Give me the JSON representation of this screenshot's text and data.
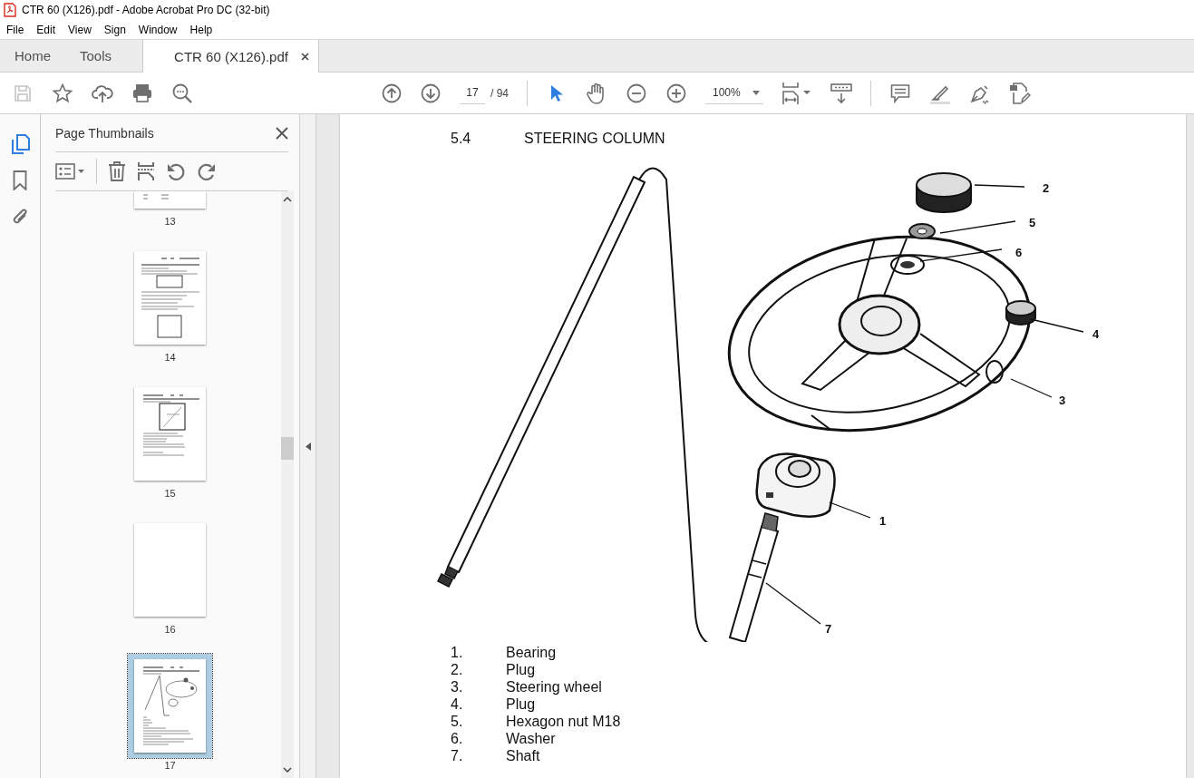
{
  "window": {
    "title": "CTR 60 (X126).pdf - Adobe Acrobat Pro DC (32-bit)"
  },
  "menu": [
    "File",
    "Edit",
    "View",
    "Sign",
    "Window",
    "Help"
  ],
  "tabs": [
    {
      "label": "Home",
      "selected": false,
      "closable": false
    },
    {
      "label": "Tools",
      "selected": false,
      "closable": false
    },
    {
      "label": "CTR 60 (X126).pdf",
      "selected": true,
      "closable": true
    }
  ],
  "toolbar": {
    "page": "17",
    "page_count": "/ 94",
    "zoom": "100%",
    "save_disabled": true
  },
  "sidebar": {
    "title": "Page Thumbnails",
    "thumbnails": [
      {
        "page": "13",
        "kind": "partial",
        "selected": false
      },
      {
        "page": "14",
        "kind": "figures",
        "selected": false
      },
      {
        "page": "15",
        "kind": "figure",
        "selected": false
      },
      {
        "page": "16",
        "kind": "blank",
        "selected": false
      },
      {
        "page": "17",
        "kind": "drawing",
        "selected": true
      }
    ]
  },
  "document": {
    "section": "5.4",
    "heading": "STEERING COLUMN",
    "callouts": [
      "2",
      "5",
      "6",
      "4",
      "3",
      "1",
      "7"
    ],
    "parts": [
      {
        "number": "1.",
        "name": "Bearing"
      },
      {
        "number": "2.",
        "name": "Plug"
      },
      {
        "number": "3.",
        "name": "Steering wheel"
      },
      {
        "number": "4.",
        "name": "Plug"
      },
      {
        "number": "5.",
        "name": "Hexagon nut M18"
      },
      {
        "number": "6.",
        "name": "Washer"
      },
      {
        "number": "7.",
        "name": "Shaft"
      }
    ]
  }
}
